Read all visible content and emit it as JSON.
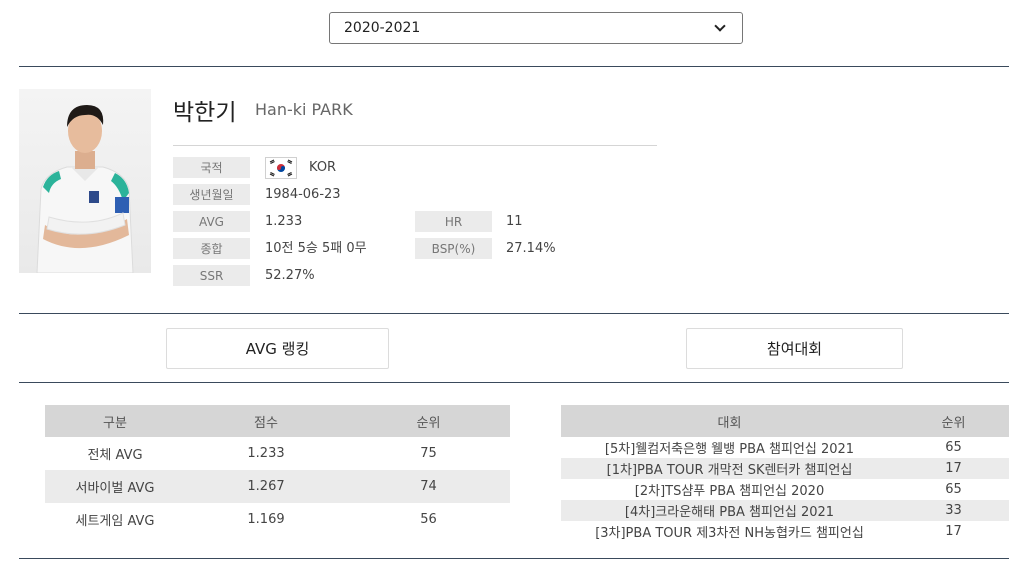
{
  "season_select": {
    "selected": "2020-2021"
  },
  "player": {
    "name_ko": "박한기",
    "name_en": "Han-ki PARK"
  },
  "profile": {
    "nationality_label": "국적",
    "nationality_value": "KOR",
    "birth_label": "생년월일",
    "birth_value": "1984-06-23",
    "avg_label": "AVG",
    "avg_value": "1.233",
    "hr_label": "HR",
    "hr_value": "11",
    "record_label": "종합",
    "record_value": "10전 5승 5패 0무",
    "bsp_label": "BSP(%)",
    "bsp_value": "27.14%",
    "ssr_label": "SSR",
    "ssr_value": "52.27%"
  },
  "tabs": {
    "avg_ranking": "AVG 랭킹",
    "tournaments": "참여대회"
  },
  "ranking_table": {
    "headers": [
      "구분",
      "점수",
      "순위"
    ],
    "rows": [
      [
        "전체 AVG",
        "1.233",
        "75"
      ],
      [
        "서바이벌 AVG",
        "1.267",
        "74"
      ],
      [
        "세트게임 AVG",
        "1.169",
        "56"
      ]
    ]
  },
  "tournament_table": {
    "headers": [
      "대회",
      "순위"
    ],
    "rows": [
      [
        "[5차]웰컴저축은행 웰뱅 PBA 챔피언십 2021",
        "65"
      ],
      [
        "[1차]PBA TOUR 개막전 SK렌터카 챔피언십",
        "17"
      ],
      [
        "[2차]TS샴푸 PBA 챔피언십 2020",
        "65"
      ],
      [
        "[4차]크라운해태 PBA 챔피언십 2021",
        "33"
      ],
      [
        "[3차]PBA TOUR 제3차전 NH농협카드 챔피언십",
        "17"
      ]
    ]
  },
  "colors": {
    "divider": "#3a4a5c",
    "table_header": "#d6d6d6",
    "row_alt": "#ebebeb",
    "label_bg": "#ebebeb"
  }
}
